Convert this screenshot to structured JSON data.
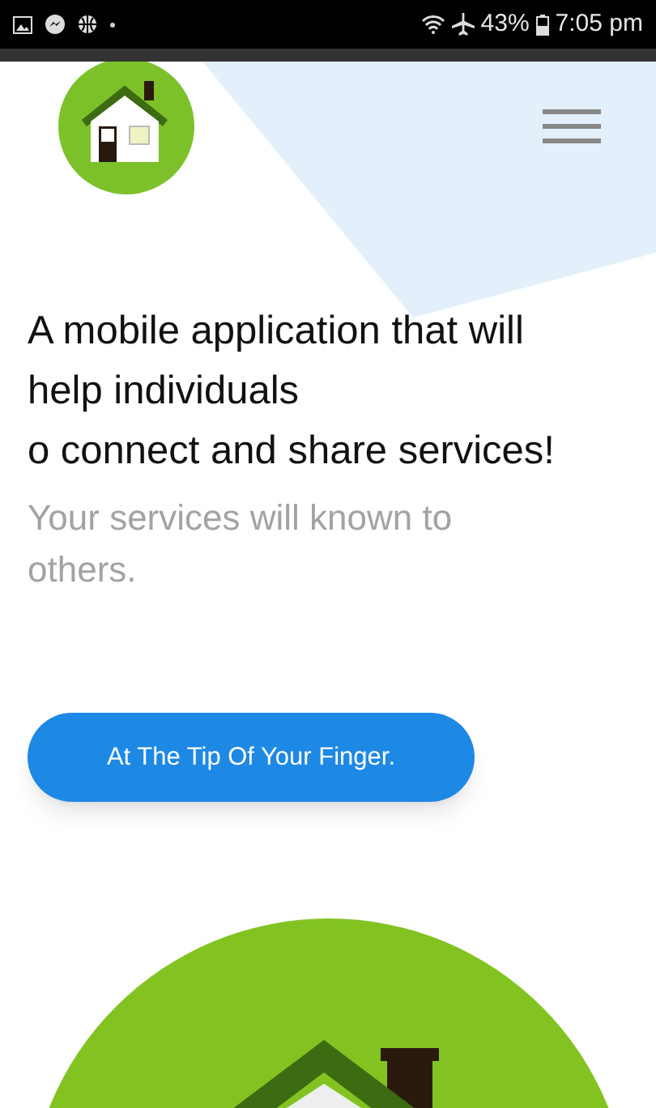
{
  "status_bar": {
    "battery": "43%",
    "time": "7:05 pm"
  },
  "hero": {
    "heading_lines": [
      "A mobile application that will help individuals",
      "o connect and share services!"
    ],
    "subtitle": "Your services will known to others.",
    "button": "At The Tip Of Your Finger."
  }
}
